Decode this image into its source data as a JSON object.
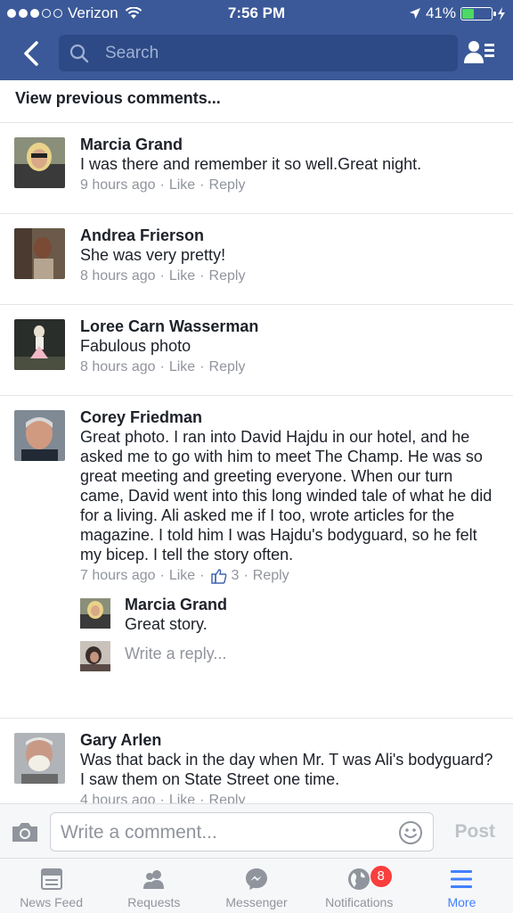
{
  "status_bar": {
    "carrier": "Verizon",
    "time": "7:56 PM",
    "battery_percent": "41%",
    "battery_level": 0.41
  },
  "nav": {
    "search_placeholder": "Search"
  },
  "view_previous_label": "View previous comments...",
  "comments": [
    {
      "name": "Marcia Grand",
      "text": "I was there and remember it so well.Great night.",
      "time": "9 hours ago",
      "like": "Like",
      "reply": "Reply"
    },
    {
      "name": "Andrea Frierson",
      "text": "She was very pretty!",
      "time": "8 hours ago",
      "like": "Like",
      "reply": "Reply"
    },
    {
      "name": "Loree Carn Wasserman",
      "text": "Fabulous photo",
      "time": "8 hours ago",
      "like": "Like",
      "reply": "Reply"
    },
    {
      "name": "Corey Friedman",
      "text": "Great photo. I ran into David Hajdu in our hotel, and he asked me to go with him to meet The Champ. He was so great meeting and greeting everyone. When our turn came, David went into this long winded tale of what he did for a living. Ali asked me if I too, wrote articles for the magazine. I told him I was Hajdu's bodyguard, so he felt my bicep. I tell the story often.",
      "time": "7 hours ago",
      "like": "Like",
      "like_count": "3",
      "reply": "Reply",
      "replies": [
        {
          "name": "Marcia Grand",
          "text": "Great story."
        }
      ],
      "write_reply_placeholder": "Write a reply..."
    },
    {
      "name": "Gary Arlen",
      "text": "Was that back in the day when Mr. T was Ali's bodyguard?  I saw them on State Street one time.",
      "time": "4 hours ago",
      "like": "Like",
      "reply": "Reply"
    }
  ],
  "composer": {
    "placeholder": "Write a comment...",
    "post_label": "Post"
  },
  "tabs": [
    {
      "label": "News Feed",
      "icon": "news-feed-icon"
    },
    {
      "label": "Requests",
      "icon": "friend-requests-icon"
    },
    {
      "label": "Messenger",
      "icon": "messenger-icon"
    },
    {
      "label": "Notifications",
      "icon": "globe-icon",
      "badge": "8"
    },
    {
      "label": "More",
      "icon": "menu-icon",
      "active": true
    }
  ],
  "colors": {
    "brand": "#3b5998",
    "active_tab": "#4080ff",
    "badge": "#fa3e3e",
    "meta_text": "#90949c"
  }
}
